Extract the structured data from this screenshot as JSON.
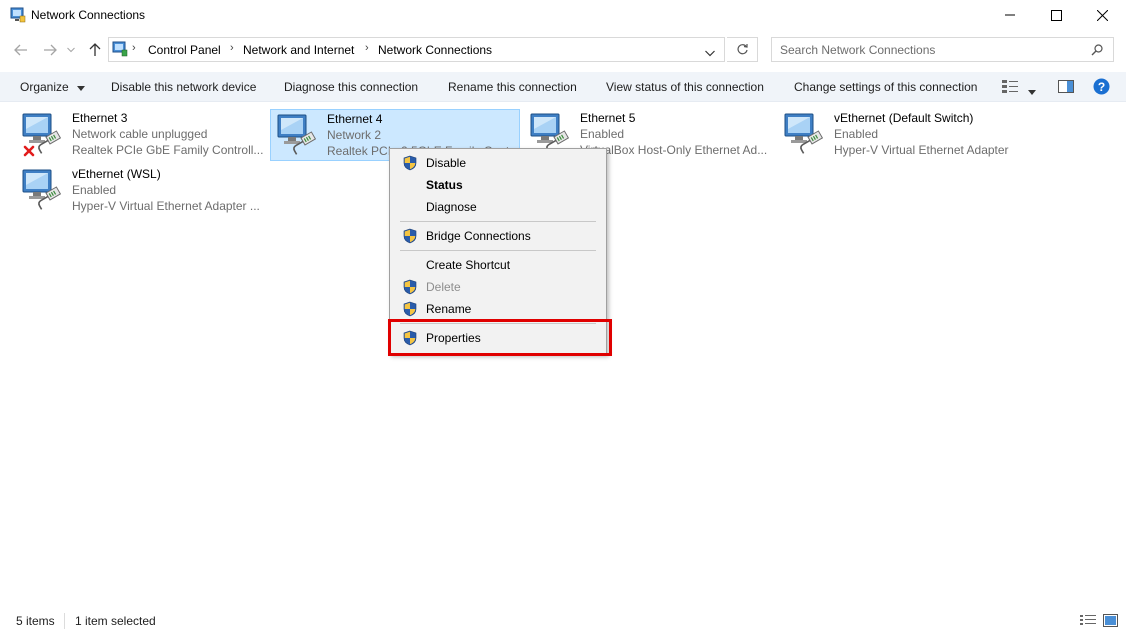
{
  "window": {
    "title": "Network Connections"
  },
  "address": {
    "breadcrumbs": [
      "Control Panel",
      "Network and Internet",
      "Network Connections"
    ],
    "search_placeholder": "Search Network Connections"
  },
  "commands": {
    "organize": "Organize",
    "disable": "Disable this network device",
    "diagnose": "Diagnose this connection",
    "rename": "Rename this connection",
    "view_status": "View status of this connection",
    "change_settings": "Change settings of this connection"
  },
  "connections": [
    {
      "name": "Ethernet 3",
      "status": "Network cable unplugged",
      "adapter": "Realtek PCIe GbE Family Controll...",
      "disconnected": true,
      "selected": false
    },
    {
      "name": "Ethernet 4",
      "status": "Network 2",
      "adapter": "Realtek PCIe 2.5GbE Family Controll...",
      "disconnected": false,
      "selected": true
    },
    {
      "name": "Ethernet 5",
      "status": "Enabled",
      "adapter": "VirtualBox Host-Only Ethernet Ad...",
      "disconnected": false,
      "selected": false
    },
    {
      "name": "vEthernet (Default Switch)",
      "status": "Enabled",
      "adapter": "Hyper-V Virtual Ethernet Adapter",
      "disconnected": false,
      "selected": false
    },
    {
      "name": "vEthernet (WSL)",
      "status": "Enabled",
      "adapter": "Hyper-V Virtual Ethernet Adapter ...",
      "disconnected": false,
      "selected": false
    }
  ],
  "context_menu": {
    "disable": "Disable",
    "status": "Status",
    "diagnose": "Diagnose",
    "bridge": "Bridge Connections",
    "create_shortcut": "Create Shortcut",
    "delete": "Delete",
    "rename": "Rename",
    "properties": "Properties"
  },
  "statusbar": {
    "count": "5 items",
    "selected": "1 item selected"
  },
  "colors": {
    "selection_bg": "#cce8ff",
    "selection_border": "#99d1ff",
    "highlight_box": "#e00000",
    "command_bar_bg": "#f0f4f9",
    "help_icon": "#1a6fd1"
  }
}
